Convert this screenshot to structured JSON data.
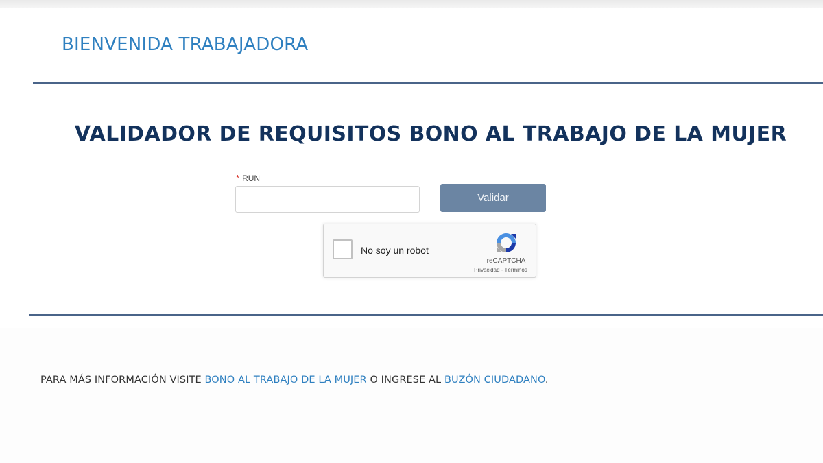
{
  "header": {
    "welcome": "BIENVENIDA TRABAJADORA"
  },
  "main": {
    "title": "VALIDADOR DE REQUISITOS BONO AL TRABAJO DE LA MUJER",
    "run_required_mark": "*",
    "run_label": "RUN",
    "run_value": "",
    "validate_label": "Validar"
  },
  "recaptcha": {
    "label": "No soy un robot",
    "brand": "reCAPTCHA",
    "links": "Privacidad - Términos"
  },
  "footer": {
    "prefix": "PARA MÁS INFORMACIÓN VISITE ",
    "link1": "BONO AL TRABAJO DE LA MUJER",
    "middle": " O INGRESE AL ",
    "link2": "BUZÓN CIUDADANO",
    "suffix": "."
  },
  "colors": {
    "heading_blue": "#2f80c0",
    "title_navy": "#13325c",
    "divider": "#4a6489",
    "button": "#6b85a3",
    "required": "#d9342b"
  }
}
